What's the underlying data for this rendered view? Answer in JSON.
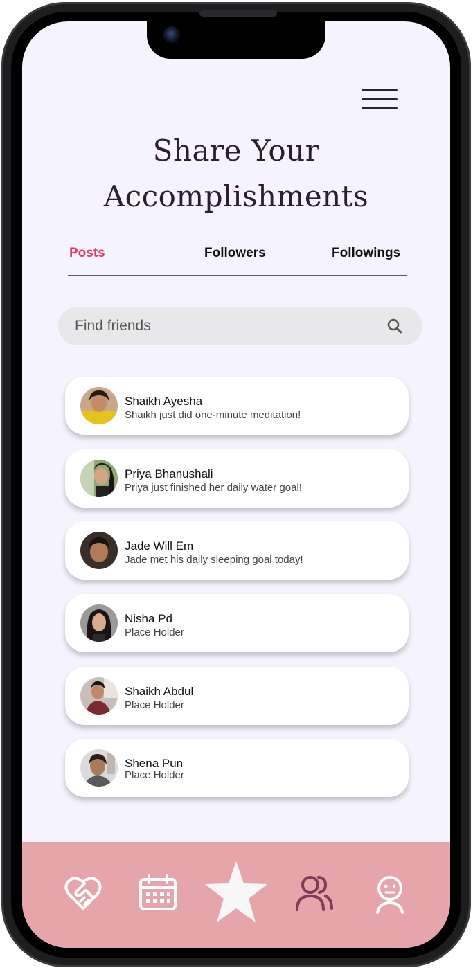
{
  "header": {
    "menu_icon": "hamburger-menu-icon",
    "title_line1": "Share Your",
    "title_line2": "Accomplishments"
  },
  "tabs": [
    {
      "label": "Posts",
      "active": true
    },
    {
      "label": "Followers",
      "active": false
    },
    {
      "label": "Followings",
      "active": false
    }
  ],
  "search": {
    "placeholder": "Find friends",
    "icon": "search-icon"
  },
  "feed": [
    {
      "name": "Shaikh Ayesha",
      "message": "Shaikh just did one-minute meditation!"
    },
    {
      "name": "Priya Bhanushali",
      "message": "Priya just finished her daily water goal!"
    },
    {
      "name": "Jade Will Em",
      "message": "Jade met his daily sleeping goal today!"
    },
    {
      "name": "Nisha Pd",
      "message": "Place Holder"
    },
    {
      "name": "Shaikh Abdul",
      "message": "Place Holder"
    },
    {
      "name": "Shena Pun",
      "message": "Place Holder"
    }
  ],
  "bottom_nav": [
    {
      "icon": "heart-handshake-icon"
    },
    {
      "icon": "calendar-icon"
    },
    {
      "icon": "star-icon",
      "active": true
    },
    {
      "icon": "people-icon"
    },
    {
      "icon": "profile-icon"
    }
  ],
  "colors": {
    "accent": "#e83a5e",
    "background": "#f5f4fe",
    "nav_background": "#e5a5ab",
    "title": "#2e1c33"
  }
}
